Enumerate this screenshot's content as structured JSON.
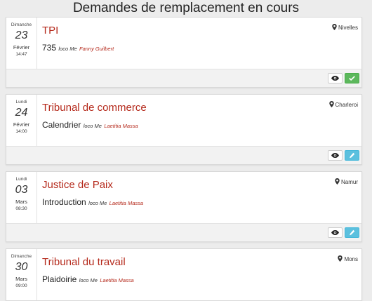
{
  "page": {
    "title": "Demandes de remplacement en cours"
  },
  "requests": [
    {
      "weekday": "Dimanche",
      "day": "23",
      "month": "Février",
      "time": "14:47",
      "court": "TPI",
      "subject": "735",
      "loco": "loco Me",
      "lawyer": "Fanny Guilbert",
      "location": "Nivelles",
      "action": "accept"
    },
    {
      "weekday": "Lundi",
      "day": "24",
      "month": "Février",
      "time": "14:00",
      "court": "Tribunal de commerce",
      "subject": "Calendrier",
      "loco": "loco Me",
      "lawyer": "Laetitia Massa",
      "location": "Charleroi",
      "action": "edit"
    },
    {
      "weekday": "Lundi",
      "day": "03",
      "month": "Mars",
      "time": "08:30",
      "court": "Justice de Paix",
      "subject": "Introduction",
      "loco": "loco Me",
      "lawyer": "Laetitia Massa",
      "location": "Namur",
      "action": "edit"
    },
    {
      "weekday": "Dimanche",
      "day": "30",
      "month": "Mars",
      "time": "09:00",
      "court": "Tribunal du travail",
      "subject": "Plaidoirie",
      "loco": "loco Me",
      "lawyer": "Laetitia Massa",
      "location": "Mons",
      "action": "edit"
    }
  ],
  "icons": {
    "view": "eye-icon",
    "accept": "check-icon",
    "edit": "pencil-icon",
    "location": "map-marker-icon"
  },
  "colors": {
    "court": "#b52a1c",
    "accept": "#5cb85c",
    "edit": "#5bc0de"
  }
}
